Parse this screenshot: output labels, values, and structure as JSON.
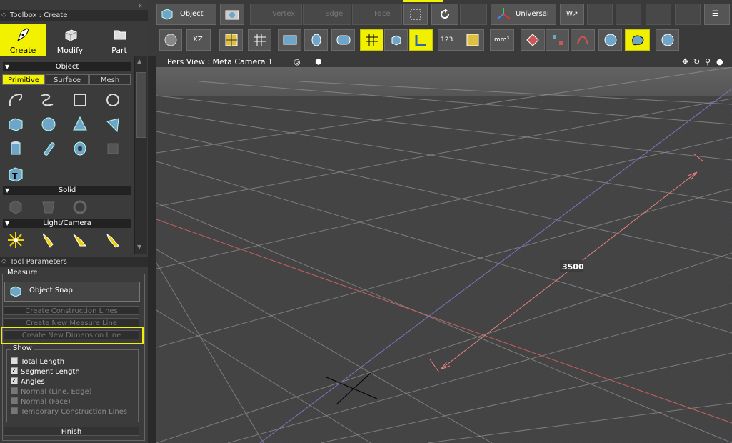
{
  "toolbox": {
    "title": "Toolbox : Create",
    "tabs": [
      {
        "label": "Create",
        "icon": "pen-icon",
        "active": true
      },
      {
        "label": "Modify",
        "icon": "cube-icon",
        "active": false
      },
      {
        "label": "Part",
        "icon": "folder-icon",
        "active": false
      }
    ],
    "object_header": "Object",
    "subtabs": [
      {
        "label": "Primitive",
        "active": true
      },
      {
        "label": "Surface",
        "active": false
      },
      {
        "label": "Mesh",
        "active": false
      }
    ],
    "primitive_icons": [
      "curve-open-icon",
      "curve-loop-icon",
      "rectangle-icon",
      "circle-icon",
      "box-icon",
      "sphere-icon",
      "cone-icon",
      "disk-icon",
      "cylinder-icon",
      "capsule-icon",
      "torus-icon",
      "polygon-icon",
      "text-icon"
    ],
    "solid_header": "Solid",
    "solid_icons": [
      "solid-box-icon",
      "solid-cup-icon",
      "solid-ring-icon"
    ],
    "light_header": "Light/Camera",
    "light_icons": [
      "point-light-icon",
      "spot-light-icon",
      "parallel-light-icon",
      "camera-icon"
    ]
  },
  "tool_params": {
    "title": "Tool Parameters",
    "group": "Measure",
    "object_snap": "Object Snap",
    "buttons": [
      "Create Construction Lines",
      "Create New Measure Line",
      "Create New Dimension Line"
    ],
    "show_label": "Show",
    "options": [
      {
        "label": "Total Length",
        "checked": false,
        "enabled": true
      },
      {
        "label": "Segment Length",
        "checked": true,
        "enabled": true
      },
      {
        "label": "Angles",
        "checked": true,
        "enabled": true
      },
      {
        "label": "Normal (Line, Edge)",
        "checked": false,
        "enabled": false
      },
      {
        "label": "Normal (Face)",
        "checked": false,
        "enabled": false
      },
      {
        "label": "Temporary Construction Lines",
        "checked": false,
        "enabled": false
      }
    ],
    "finish": "Finish"
  },
  "toolbar": {
    "row1": {
      "object": "Object",
      "vertex": "Vertex",
      "edge": "Edge",
      "face": "Face",
      "universal": "Universal",
      "plane": "XZ"
    },
    "grid_val": "123.."
  },
  "viewport": {
    "title": "Pers View : Meta Camera 1",
    "measure_value": "3500"
  },
  "colors": {
    "accent": "#f2f200",
    "measure": "#e88080",
    "grid": "#8f8f8f"
  }
}
